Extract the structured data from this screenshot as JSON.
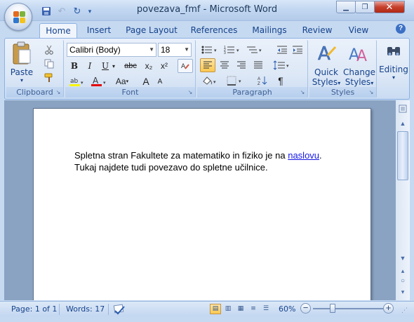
{
  "window": {
    "title": "povezava_fmf - Microsoft Word"
  },
  "titlebar": {
    "minimize_glyph": "▁",
    "restore_glyph": "❐",
    "close_glyph": "✕"
  },
  "qat": {
    "save_glyph": "💾",
    "undo_glyph": "↶",
    "redo_glyph": "↻",
    "customize_glyph": "▾"
  },
  "tabs": [
    {
      "label": "Home",
      "active": true
    },
    {
      "label": "Insert"
    },
    {
      "label": "Page Layout"
    },
    {
      "label": "References"
    },
    {
      "label": "Mailings"
    },
    {
      "label": "Review"
    },
    {
      "label": "View"
    }
  ],
  "help": {
    "glyph": "?"
  },
  "ribbon": {
    "clipboard": {
      "label": "Clipboard",
      "paste": "Paste"
    },
    "font": {
      "label": "Font",
      "font_name": "Calibri (Body)",
      "font_size": "18",
      "bold": "B",
      "italic": "I",
      "underline": "U",
      "strike": "abc",
      "subscript": "x₂",
      "superscript": "x²",
      "change_case": "Aa",
      "grow": "A",
      "shrink": "A"
    },
    "paragraph": {
      "label": "Paragraph",
      "pilcrow": "¶"
    },
    "styles": {
      "label": "Styles",
      "quick_styles": [
        "Quick",
        "Styles"
      ],
      "change_styles": [
        "Change",
        "Styles"
      ]
    },
    "editing": {
      "label": "Editing"
    }
  },
  "document": {
    "line1_before": "Spletna stran Fakultete za matematiko in fiziko je na ",
    "link_text": "naslovu",
    "line1_after": ".",
    "line2": "Tukaj najdete tudi povezavo do spletne učilnice."
  },
  "status": {
    "page": "Page: 1 of 1",
    "words": "Words: 17",
    "zoom": "60%"
  },
  "colors": {
    "accent": "#15428b",
    "link": "#1518e6",
    "ribbon_bg": "#dde8f6",
    "selected": "#fbc850"
  }
}
